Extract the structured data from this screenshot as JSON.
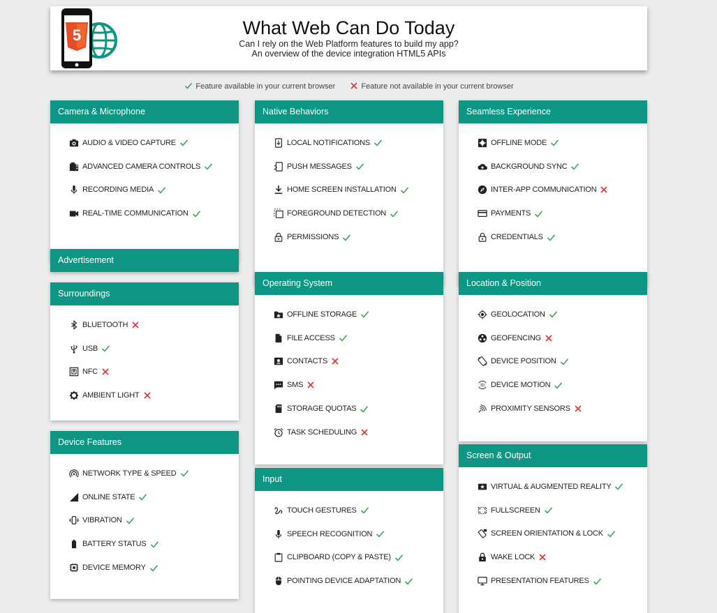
{
  "header": {
    "title": "What Web Can Do Today",
    "subtitle1": "Can I rely on the Web Platform features to build my app?",
    "subtitle2": "An overview of the device integration HTML5 APIs",
    "logo_badge_text": "5"
  },
  "legend": {
    "available": "Feature available in your current browser",
    "unavailable": "Feature not available in your current browser"
  },
  "colors": {
    "accent": "#0e9684",
    "available": "#3ba55c",
    "unavailable": "#e0312f",
    "logo_orange": "#e44d26"
  },
  "cards": [
    {
      "id": "camera",
      "title": "Camera & Microphone",
      "items": [
        {
          "label": "Audio & Video Capture",
          "icon": "camera-icon",
          "ok": true
        },
        {
          "label": "Advanced Camera Controls",
          "icon": "camera-roll-icon",
          "ok": true
        },
        {
          "label": "Recording Media",
          "icon": "microphone-icon",
          "ok": true
        },
        {
          "label": "Real-Time Communication",
          "icon": "videocam-icon",
          "ok": true
        }
      ]
    },
    {
      "id": "advertisement",
      "title": "Advertisement",
      "items": []
    },
    {
      "id": "surroundings",
      "title": "Surroundings",
      "items": [
        {
          "label": "Bluetooth",
          "icon": "bluetooth-icon",
          "ok": false
        },
        {
          "label": "USB",
          "icon": "usb-icon",
          "ok": true
        },
        {
          "label": "NFC",
          "icon": "nfc-icon",
          "ok": false
        },
        {
          "label": "Ambient Light",
          "icon": "brightness-icon",
          "ok": false
        }
      ]
    },
    {
      "id": "device",
      "title": "Device Features",
      "items": [
        {
          "label": "Network Type & Speed",
          "icon": "network-icon",
          "ok": true
        },
        {
          "label": "Online State",
          "icon": "signal-icon",
          "ok": true
        },
        {
          "label": "Vibration",
          "icon": "vibration-icon",
          "ok": true
        },
        {
          "label": "Battery Status",
          "icon": "battery-icon",
          "ok": true
        },
        {
          "label": "Device Memory",
          "icon": "memory-icon",
          "ok": true
        }
      ]
    },
    {
      "id": "native",
      "title": "Native Behaviors",
      "items": [
        {
          "label": "Local Notifications",
          "icon": "notification-icon",
          "ok": true
        },
        {
          "label": "Push Messages",
          "icon": "push-icon",
          "ok": true
        },
        {
          "label": "Home Screen Installation",
          "icon": "download-icon",
          "ok": true
        },
        {
          "label": "Foreground Detection",
          "icon": "foreground-icon",
          "ok": true
        },
        {
          "label": "Permissions",
          "icon": "lock-open-icon",
          "ok": true
        }
      ]
    },
    {
      "id": "os",
      "title": "Operating System",
      "items": [
        {
          "label": "Offline Storage",
          "icon": "folder-star-icon",
          "ok": true
        },
        {
          "label": "File Access",
          "icon": "file-icon",
          "ok": true
        },
        {
          "label": "Contacts",
          "icon": "contact-icon",
          "ok": false
        },
        {
          "label": "SMS",
          "icon": "sms-icon",
          "ok": false
        },
        {
          "label": "Storage Quotas",
          "icon": "sd-card-icon",
          "ok": true
        },
        {
          "label": "Task Scheduling",
          "icon": "alarm-icon",
          "ok": false
        }
      ]
    },
    {
      "id": "input",
      "title": "Input",
      "items": [
        {
          "label": "Touch Gestures",
          "icon": "gesture-icon",
          "ok": true
        },
        {
          "label": "Speech Recognition",
          "icon": "microphone-icon",
          "ok": true
        },
        {
          "label": "Clipboard (Copy & Paste)",
          "icon": "clipboard-icon",
          "ok": true
        },
        {
          "label": "Pointing Device Adaptation",
          "icon": "mouse-icon",
          "ok": true
        }
      ]
    },
    {
      "id": "seamless",
      "title": "Seamless Experience",
      "items": [
        {
          "label": "Offline Mode",
          "icon": "offline-icon",
          "ok": true
        },
        {
          "label": "Background Sync",
          "icon": "cloud-upload-icon",
          "ok": true
        },
        {
          "label": "Inter-App Communication",
          "icon": "compass-icon",
          "ok": false
        },
        {
          "label": "Payments",
          "icon": "credit-card-icon",
          "ok": true
        },
        {
          "label": "Credentials",
          "icon": "lock-open-icon",
          "ok": true
        }
      ]
    },
    {
      "id": "location",
      "title": "Location & Position",
      "items": [
        {
          "label": "Geolocation",
          "icon": "gps-icon",
          "ok": true
        },
        {
          "label": "Geofencing",
          "icon": "geofence-icon",
          "ok": false
        },
        {
          "label": "Device Position",
          "icon": "screen-rotation-icon",
          "ok": true
        },
        {
          "label": "Device Motion",
          "icon": "3d-rotation-icon",
          "ok": true
        },
        {
          "label": "Proximity Sensors",
          "icon": "proximity-icon",
          "ok": false
        }
      ]
    },
    {
      "id": "screen",
      "title": "Screen & Output",
      "items": [
        {
          "label": "Virtual & Augmented Reality",
          "icon": "vr-icon",
          "ok": true
        },
        {
          "label": "Fullscreen",
          "icon": "fullscreen-icon",
          "ok": true
        },
        {
          "label": "Screen Orientation & Lock",
          "icon": "screen-lock-rotation-icon",
          "ok": true
        },
        {
          "label": "Wake Lock",
          "icon": "lock-icon",
          "ok": false
        },
        {
          "label": "Presentation Features",
          "icon": "monitor-icon",
          "ok": true
        }
      ]
    }
  ]
}
